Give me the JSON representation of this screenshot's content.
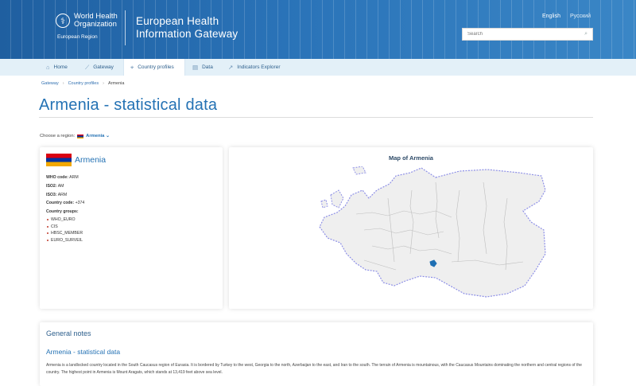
{
  "header": {
    "org_line1": "World Health",
    "org_line2": "Organization",
    "region": "European Region",
    "title_line1": "European Health",
    "title_line2": "Information Gateway",
    "lang_en": "English",
    "lang_ru": "Русский",
    "search_placeholder": "Search"
  },
  "nav": {
    "home": "Home",
    "gateway": "Gateway",
    "country_profiles": "Country profiles",
    "data": "Data",
    "indicators_explorer": "Indicators Explorer"
  },
  "breadcrumb": {
    "item1": "Gateway",
    "item2": "Country profiles",
    "current": "Armenia"
  },
  "page_title": "Armenia - statistical data",
  "region_chooser": {
    "label": "Choose a region:",
    "selected": "Armenia"
  },
  "country_card": {
    "name": "Armenia",
    "who_code_label": "WHO code:",
    "who_code": "ARM",
    "iso2_label": "ISO2:",
    "iso2": "AM",
    "iso3_label": "ISO3:",
    "iso3": "ARM",
    "country_code_label": "Country code:",
    "country_code": "+374",
    "groups_label": "Country groups:",
    "groups": [
      "WHO_EURO",
      "CIS",
      "HBSC_MEMBER",
      "EURO_SURVEIL"
    ],
    "flag_colors": [
      "#d90012",
      "#0033a0",
      "#f2a800"
    ]
  },
  "map": {
    "title": "Map of Armenia",
    "highlight_color": "#1f6fb3"
  },
  "general_notes": {
    "title": "General notes",
    "subtitle": "Armenia - statistical data",
    "body": "Armenia is a landlocked country located in the South Caucasus region of Eurasia. It is bordered by Turkey to the west, Georgia to the north, Azerbaijan to the east, and Iran to the south. The terrain of Armenia is mountainous, with the Caucasus Mountains dominating the northern and central regions of the country. The highest point in Armenia is Mount Aragats, which stands at 13,419 feet above sea level."
  },
  "colors": {
    "accent": "#2472b4",
    "header": "#2a73b8",
    "nav_bg": "#e3f0f8"
  }
}
